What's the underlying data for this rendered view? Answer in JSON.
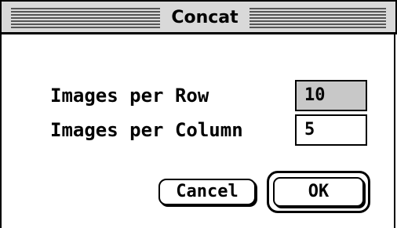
{
  "window": {
    "title": "Concat"
  },
  "fields": {
    "images_per_row": {
      "label": "Images per Row",
      "value": "10"
    },
    "images_per_column": {
      "label": "Images per Column",
      "value": "5"
    }
  },
  "buttons": {
    "cancel_label": "Cancel",
    "ok_label": "OK"
  }
}
